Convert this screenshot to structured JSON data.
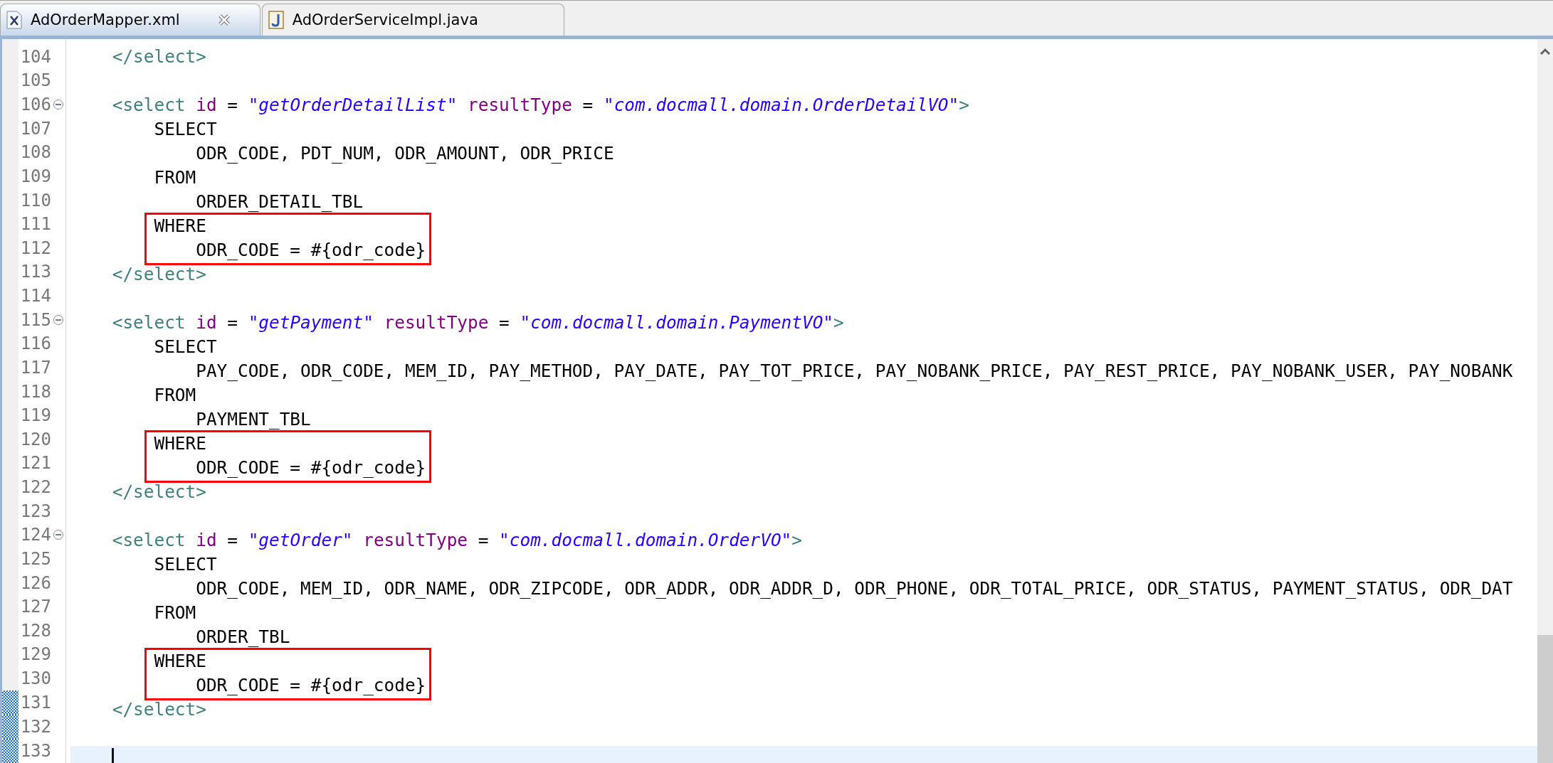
{
  "tabs": [
    {
      "label": "AdOrderMapper.xml",
      "kind": "xml",
      "selected": true,
      "closable": true
    },
    {
      "label": "AdOrderServiceImpl.java",
      "kind": "java",
      "selected": false,
      "closable": false
    }
  ],
  "lines": [
    {
      "number": "104",
      "tokens": [
        {
          "kind": "tag",
          "text": "    </select>"
        }
      ]
    },
    {
      "number": "105"
    },
    {
      "number": "106",
      "expanded": true,
      "tokens": [
        {
          "kind": "tag",
          "text": "    <select"
        },
        {
          "kind": "attr",
          "text": " id"
        },
        {
          "kind": "plain",
          "text": " = "
        },
        {
          "kind": "value",
          "text": "\"getOrderDetailList\""
        },
        {
          "kind": "attr",
          "text": " resultType"
        },
        {
          "kind": "plain",
          "text": " = "
        },
        {
          "kind": "value",
          "text": "\"com.docmall.domain.OrderDetailVO\""
        },
        {
          "kind": "tag",
          "text": ">"
        }
      ]
    },
    {
      "number": "107",
      "tokens": [
        {
          "kind": "plain",
          "text": "        SELECT"
        }
      ]
    },
    {
      "number": "108",
      "tokens": [
        {
          "kind": "plain",
          "text": "            ODR_CODE, PDT_NUM, ODR_AMOUNT, ODR_PRICE"
        }
      ]
    },
    {
      "number": "109",
      "tokens": [
        {
          "kind": "plain",
          "text": "        FROM"
        }
      ]
    },
    {
      "number": "110",
      "tokens": [
        {
          "kind": "plain",
          "text": "            ORDER_DETAIL_TBL"
        }
      ]
    },
    {
      "number": "111",
      "boxed": true,
      "tokens": [
        {
          "kind": "plain",
          "text": "        WHERE"
        }
      ]
    },
    {
      "number": "112",
      "boxed": true,
      "tokens": [
        {
          "kind": "plain",
          "text": "            ODR_CODE = #{odr_code}"
        }
      ]
    },
    {
      "number": "113",
      "tokens": [
        {
          "kind": "tag",
          "text": "    </select>"
        }
      ]
    },
    {
      "number": "114"
    },
    {
      "number": "115",
      "expanded": true,
      "tokens": [
        {
          "kind": "tag",
          "text": "    <select"
        },
        {
          "kind": "attr",
          "text": " id"
        },
        {
          "kind": "plain",
          "text": " = "
        },
        {
          "kind": "value",
          "text": "\"getPayment\""
        },
        {
          "kind": "attr",
          "text": " resultType"
        },
        {
          "kind": "plain",
          "text": " = "
        },
        {
          "kind": "value",
          "text": "\"com.docmall.domain.PaymentVO\""
        },
        {
          "kind": "tag",
          "text": ">"
        }
      ]
    },
    {
      "number": "116",
      "tokens": [
        {
          "kind": "plain",
          "text": "        SELECT"
        }
      ]
    },
    {
      "number": "117",
      "tokens": [
        {
          "kind": "plain",
          "text": "            PAY_CODE, ODR_CODE, MEM_ID, PAY_METHOD, PAY_DATE, PAY_TOT_PRICE, PAY_NOBANK_PRICE, PAY_REST_PRICE, PAY_NOBANK_USER, PAY_NOBANK"
        }
      ]
    },
    {
      "number": "118",
      "tokens": [
        {
          "kind": "plain",
          "text": "        FROM"
        }
      ]
    },
    {
      "number": "119",
      "tokens": [
        {
          "kind": "plain",
          "text": "            PAYMENT_TBL"
        }
      ]
    },
    {
      "number": "120",
      "boxed": true,
      "tokens": [
        {
          "kind": "plain",
          "text": "        WHERE"
        }
      ]
    },
    {
      "number": "121",
      "boxed": true,
      "tokens": [
        {
          "kind": "plain",
          "text": "            ODR_CODE = #{odr_code}"
        }
      ]
    },
    {
      "number": "122",
      "tokens": [
        {
          "kind": "tag",
          "text": "    </select>"
        }
      ]
    },
    {
      "number": "123"
    },
    {
      "number": "124",
      "expanded": true,
      "tokens": [
        {
          "kind": "tag",
          "text": "    <select"
        },
        {
          "kind": "attr",
          "text": " id"
        },
        {
          "kind": "plain",
          "text": " = "
        },
        {
          "kind": "value",
          "text": "\"getOrder\""
        },
        {
          "kind": "attr",
          "text": " resultType"
        },
        {
          "kind": "plain",
          "text": " = "
        },
        {
          "kind": "value",
          "text": "\"com.docmall.domain.OrderVO\""
        },
        {
          "kind": "tag",
          "text": ">"
        }
      ]
    },
    {
      "number": "125",
      "tokens": [
        {
          "kind": "plain",
          "text": "        SELECT"
        }
      ]
    },
    {
      "number": "126",
      "tokens": [
        {
          "kind": "plain",
          "text": "            ODR_CODE, MEM_ID, ODR_NAME, ODR_ZIPCODE, ODR_ADDR, ODR_ADDR_D, ODR_PHONE, ODR_TOTAL_PRICE, ODR_STATUS, PAYMENT_STATUS, ODR_DAT"
        }
      ]
    },
    {
      "number": "127",
      "tokens": [
        {
          "kind": "plain",
          "text": "        FROM"
        }
      ]
    },
    {
      "number": "128",
      "tokens": [
        {
          "kind": "plain",
          "text": "            ORDER_TBL"
        }
      ]
    },
    {
      "number": "129",
      "boxed": true,
      "tokens": [
        {
          "kind": "plain",
          "text": "        WHERE"
        }
      ]
    },
    {
      "number": "130",
      "boxed": true,
      "tokens": [
        {
          "kind": "plain",
          "text": "            ODR_CODE = #{odr_code}"
        }
      ]
    },
    {
      "number": "131",
      "changed": true,
      "tokens": [
        {
          "kind": "tag",
          "text": "    </select>"
        }
      ]
    },
    {
      "number": "132",
      "changed": true
    },
    {
      "number": "133",
      "changed": true,
      "current": true
    }
  ]
}
